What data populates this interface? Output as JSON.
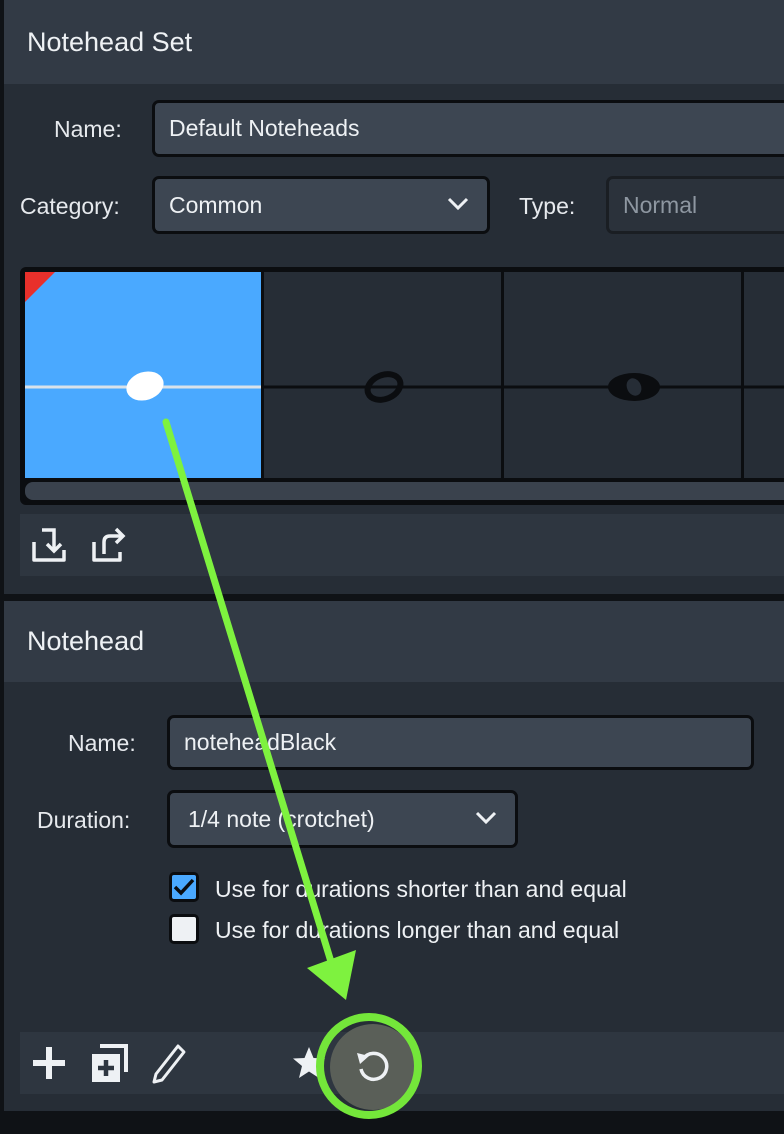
{
  "notehead_set": {
    "title": "Notehead Set",
    "name_label": "Name:",
    "name_value": "Default Noteheads",
    "category_label": "Category:",
    "category_value": "Common",
    "type_label": "Type:",
    "type_value": "Normal",
    "toolbar": {
      "import_icon": "import-icon",
      "export_icon": "export-icon"
    }
  },
  "notehead": {
    "title": "Notehead",
    "name_label": "Name:",
    "name_value": "noteheadBlack",
    "duration_label": "Duration:",
    "duration_value": "1/4 note (crotchet)",
    "checkboxes": [
      {
        "label": "Use for durations shorter than and equal",
        "checked": true
      },
      {
        "label": "Use for durations longer than and equal",
        "checked": false
      }
    ],
    "toolbar": {
      "icons": [
        "add-icon",
        "duplicate-icon",
        "edit-icon",
        "star-icon",
        "reset-icon"
      ]
    }
  },
  "colors": {
    "selected_cell": "#4aa9ff",
    "highlight_ring": "#74e63a",
    "arrow": "#7ef23f"
  }
}
